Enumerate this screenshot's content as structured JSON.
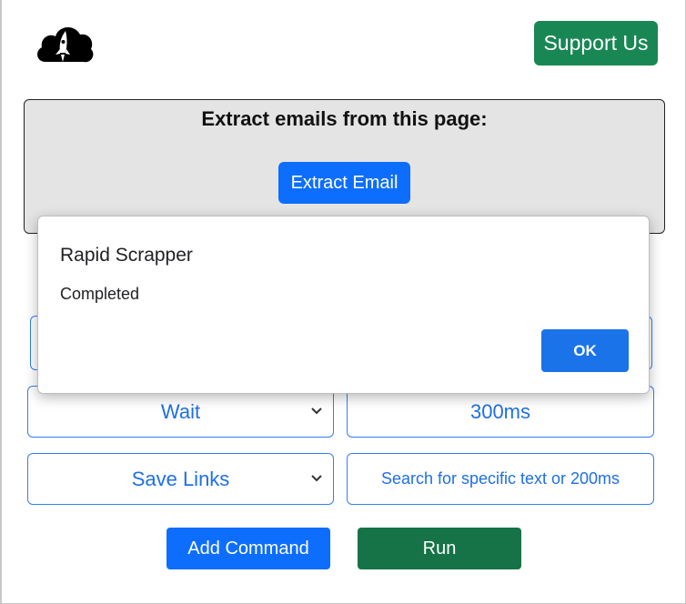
{
  "header": {
    "logo_icon": "cloud-rocket-icon",
    "support_label": "Support Us"
  },
  "extract": {
    "title": "Extract emails from this page:",
    "button_label": "Extract Email"
  },
  "commands": [
    {
      "type": "Wait",
      "value": "300ms"
    },
    {
      "type": "Save Links",
      "value": "",
      "placeholder": "Search for specific text or 200ms"
    }
  ],
  "actions": {
    "add_label": "Add Command",
    "run_label": "Run"
  },
  "dialog": {
    "title": "Rapid Scrapper",
    "message": "Completed",
    "ok_label": "OK"
  },
  "colors": {
    "primary": "#0d6efd",
    "success": "#198754",
    "dialog_ok": "#1a73e8"
  }
}
